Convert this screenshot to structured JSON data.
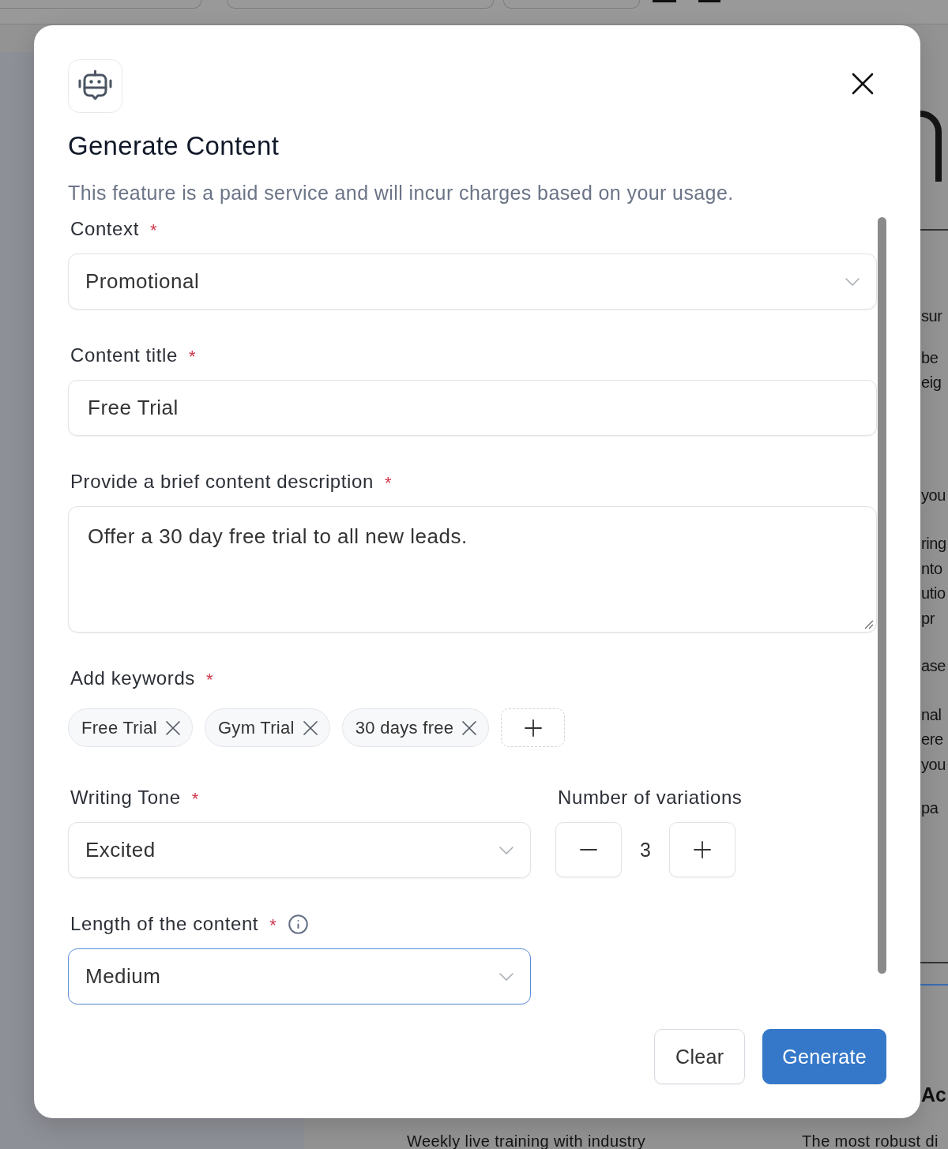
{
  "backdrop": {
    "side_paragraphs": [
      [
        "sur"
      ],
      [
        "be",
        "eig"
      ],
      [
        "you"
      ],
      [
        "ring",
        "nto",
        "utio",
        "pr"
      ],
      [
        "ase"
      ],
      [
        "nal",
        "ere",
        "you"
      ],
      [
        "pa"
      ]
    ],
    "side_heading": "Ac",
    "bottom_texts": [
      "Weekly live training with industry",
      "The most robust di"
    ]
  },
  "dialog": {
    "title": "Generate Content",
    "description": "This feature is a paid service and will incur charges based on your usage.",
    "fields": [
      {
        "kind": "select",
        "label": "Context",
        "required_mark": "*",
        "value": "Promotional",
        "focused": false
      },
      {
        "kind": "input",
        "label": "Content title",
        "required_mark": "*",
        "value": "Free Trial"
      },
      {
        "kind": "textarea",
        "label": "Provide a brief content description",
        "required_mark": "*",
        "value": "Offer a 30 day free trial to all new leads."
      },
      {
        "kind": "keywords",
        "label": "Add keywords",
        "required_mark": "*",
        "keywords": [
          "Free Trial",
          "Gym Trial",
          "30 days free"
        ]
      },
      {
        "kind": "pair",
        "items": [
          {
            "kind": "select",
            "label": "Writing Tone",
            "required_mark": "*",
            "value": "Excited",
            "focused": false
          },
          {
            "kind": "stepper",
            "label": "Number of variations",
            "value": "3"
          }
        ]
      },
      {
        "kind": "select",
        "label": "Length of the content",
        "required_mark": "*",
        "info": true,
        "value": "Medium",
        "focused": true
      }
    ],
    "buttons": [
      {
        "label": "Clear",
        "kind": "secondary"
      },
      {
        "label": "Generate",
        "kind": "primary"
      }
    ]
  }
}
